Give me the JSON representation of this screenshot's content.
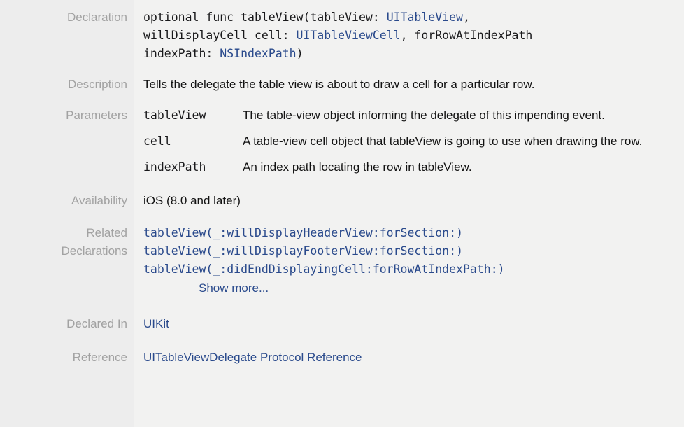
{
  "panel": {
    "background_color": "#ededed",
    "content_background_color": "#f2f2f1",
    "label_color": "#a2a2a2",
    "link_color": "#2a4a8c",
    "text_color": "#121212"
  },
  "labels": {
    "declaration": "Declaration",
    "description": "Description",
    "parameters": "Parameters",
    "availability": "Availability",
    "related_declarations_line1": "Related",
    "related_declarations_line2": "Declarations",
    "declared_in": "Declared In",
    "reference": "Reference"
  },
  "declaration": {
    "line1_pre": "optional func tableView(tableView: ",
    "line1_type": "UITableView",
    "line1_post": ",",
    "line2_pre": "willDisplayCell cell: ",
    "line2_type": "UITableViewCell",
    "line2_post": ", forRowAtIndexPath",
    "line3_pre": "indexPath: ",
    "line3_type": "NSIndexPath",
    "line3_post": ")",
    "full_text": "optional func tableView(tableView: UITableView, willDisplayCell cell: UITableViewCell, forRowAtIndexPath indexPath: NSIndexPath)"
  },
  "description": {
    "text": "Tells the delegate the table view is about to draw a cell for a particular row."
  },
  "parameters": [
    {
      "name": "tableView",
      "description": "The table-view object informing the delegate of this impending event."
    },
    {
      "name": "cell",
      "description": "A table-view cell object that tableView is going to use when drawing the row."
    },
    {
      "name": "indexPath",
      "description": "An index path locating the row in tableView."
    }
  ],
  "availability": {
    "text": "iOS (8.0 and later)"
  },
  "related_declarations": {
    "items": [
      "tableView(_:willDisplayHeaderView:forSection:)",
      "tableView(_:willDisplayFooterView:forSection:)",
      "tableView(_:didEndDisplayingCell:forRowAtIndexPath:)"
    ],
    "show_more_label": "Show more..."
  },
  "declared_in": {
    "text": "UIKit"
  },
  "reference": {
    "text": "UITableViewDelegate Protocol Reference"
  }
}
